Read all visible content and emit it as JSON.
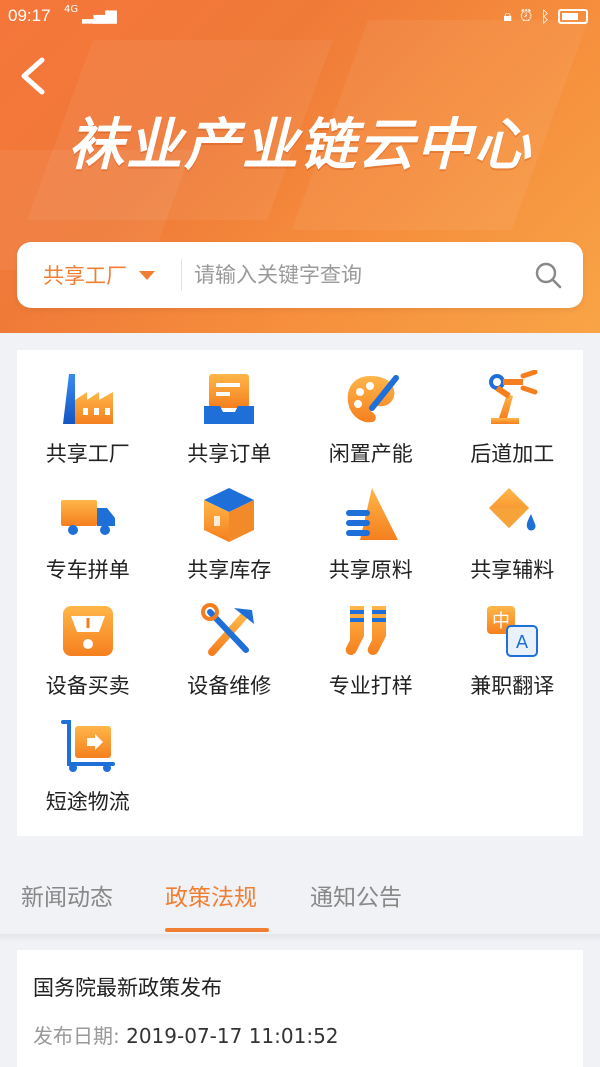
{
  "status_bar": {
    "time": "09:17",
    "network": "4G"
  },
  "header": {
    "title": "袜业产业链云中心"
  },
  "search": {
    "category": "共享工厂",
    "placeholder": "请输入关键字查询"
  },
  "grid": [
    {
      "label": "共享工厂",
      "icon": "factory-icon"
    },
    {
      "label": "共享订单",
      "icon": "order-tray-icon"
    },
    {
      "label": "闲置产能",
      "icon": "palette-icon"
    },
    {
      "label": "后道加工",
      "icon": "robot-arm-icon"
    },
    {
      "label": "专车拼单",
      "icon": "truck-icon"
    },
    {
      "label": "共享库存",
      "icon": "box-icon"
    },
    {
      "label": "共享原料",
      "icon": "material-stack-icon"
    },
    {
      "label": "共享辅料",
      "icon": "paint-bucket-icon"
    },
    {
      "label": "设备买卖",
      "icon": "gauge-device-icon"
    },
    {
      "label": "设备维修",
      "icon": "tools-icon"
    },
    {
      "label": "专业打样",
      "icon": "socks-icon"
    },
    {
      "label": "兼职翻译",
      "icon": "translate-icon"
    },
    {
      "label": "短途物流",
      "icon": "hand-cart-icon"
    }
  ],
  "tabs": [
    {
      "label": "新闻动态",
      "active": false
    },
    {
      "label": "政策法规",
      "active": true
    },
    {
      "label": "通知公告",
      "active": false
    }
  ],
  "news": [
    {
      "title": "国务院最新政策发布",
      "date_label": "发布日期:",
      "date": "2019-07-17 11:01:52"
    }
  ],
  "colors": {
    "accent": "#f07f34",
    "icon_blue": "#1f6fd8",
    "header_orange": "#f6763a"
  }
}
